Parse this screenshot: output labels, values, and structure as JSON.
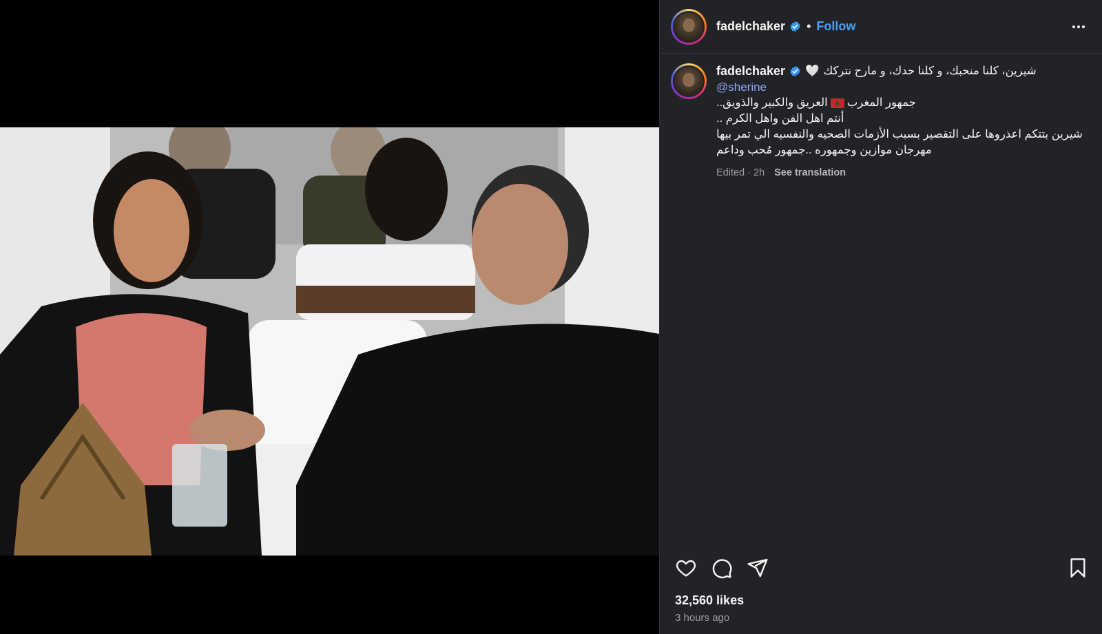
{
  "post": {
    "username": "fadelchaker",
    "follow_label": "Follow",
    "separator": "•"
  },
  "caption": {
    "username": "fadelchaker",
    "first_line": "شيرين، كلنا منحبك، و كلنا حدك، و مارح نتركك",
    "heart": "🤍",
    "mention": "@sherine",
    "line2_a": "جمهور المغرب",
    "line2_b": "العريق والكبير والذويق..",
    "line3": "أنتم اهل الفن واهل الكرم ..",
    "line4": "شيرين بتتكم اعذروها على التقصير بسبب الأزمات الصحيه والنفسيه الي تمر بيها",
    "line5": "مهرجان موازين وجمهوره ..جمهور مُحب وداعم",
    "edited": "Edited · 2h",
    "see_translation": "See translation"
  },
  "engagement": {
    "likes": "32,560 likes",
    "time_ago": "3 hours ago"
  },
  "colors": {
    "panel_bg": "#222326",
    "accent_link": "#4a9df8",
    "mention": "#8ea8ff",
    "verified": "#3897f0",
    "muted": "#9b9ca1"
  },
  "icons": {
    "verified": "verified-badge-icon",
    "more": "more-options-icon",
    "like": "heart-icon",
    "comment": "comment-icon",
    "share": "share-icon",
    "save": "bookmark-icon",
    "flag": "morocco-flag-icon"
  }
}
